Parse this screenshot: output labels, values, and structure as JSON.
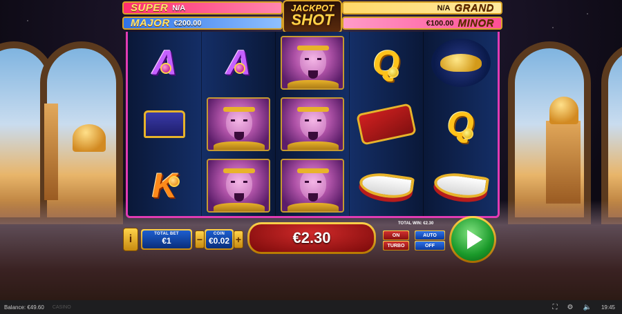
{
  "jackpot": {
    "super": {
      "name": "SUPER",
      "value": "N/A"
    },
    "major": {
      "name": "MAJOR",
      "value": "€200.00"
    },
    "grand": {
      "name": "GRAND",
      "value": "N/A"
    },
    "minor": {
      "name": "MINOR",
      "value": "€100.00"
    },
    "logo_line1": "JACKPOT",
    "logo_line2": "SHOT"
  },
  "reels": [
    [
      "A",
      "A",
      "genie",
      "Q",
      "lamp"
    ],
    [
      "chest",
      "genie",
      "genie",
      "carpet",
      "Q"
    ],
    [
      "K",
      "genie",
      "genie",
      "shoe",
      "shoe"
    ]
  ],
  "controls": {
    "info_label": "i",
    "total_bet_label": "TOTAL BET",
    "total_bet_value": "€1",
    "coin_label": "COIN",
    "coin_value": "€0.02",
    "minus_label": "−",
    "plus_label": "+",
    "win_display": "€2.30",
    "total_win_text": "TOTAL WIN: €2.30",
    "on_label": "ON",
    "turbo_label": "TURBO",
    "auto_label": "AUTO",
    "off_label": "OFF"
  },
  "statusbar": {
    "balance_text": "Balance: €49.60",
    "brand": "CASINO",
    "time": "19:45",
    "fullscreen_icon": "fullscreen-icon",
    "sound_icon": "sound-icon",
    "settings_icon": "settings-icon"
  }
}
